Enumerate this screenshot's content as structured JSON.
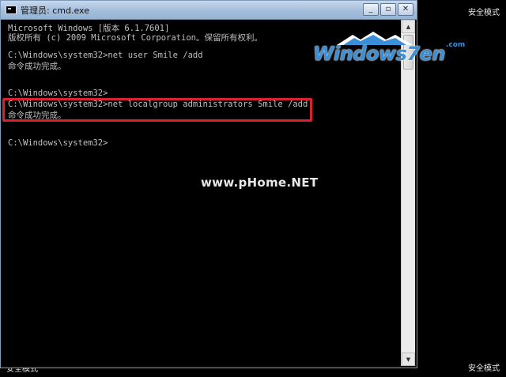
{
  "window": {
    "title": "管理员: cmd.exe",
    "controls": {
      "minimize": "_",
      "maximize": "▫",
      "close": "✕"
    }
  },
  "console": {
    "lines": [
      "Microsoft Windows [版本 6.1.7601]",
      "版权所有 (c) 2009 Microsoft Corporation。保留所有权利。",
      "",
      "C:\\Windows\\system32>net user Smile /add",
      "命令成功完成。",
      "",
      "",
      "C:\\Windows\\system32>",
      "C:\\Windows\\system32>net localgroup administrators Smile /add",
      "命令成功完成。",
      "",
      "",
      "C:\\Windows\\system32>"
    ]
  },
  "overlay": {
    "safe_mode_top_right": "安全模式",
    "safe_mode_bottom_right": "安全模式",
    "safe_mode_bottom_left": "安全模式",
    "logo_text": "Windows7en",
    "logo_suffix": ".com",
    "watermark": "www.pHome.NET"
  },
  "colors": {
    "console_bg": "#000000",
    "console_text": "#c0c0c0",
    "highlight_box": "#d9222b",
    "logo_blue": "#3b8fd6"
  },
  "icons": {
    "app": "cmd-icon",
    "minimize": "minimize-icon",
    "maximize": "maximize-icon",
    "close": "close-icon",
    "scroll_up": "arrow-up-icon",
    "scroll_down": "arrow-down-icon",
    "logo_mountain": "mountain-logo-icon"
  }
}
